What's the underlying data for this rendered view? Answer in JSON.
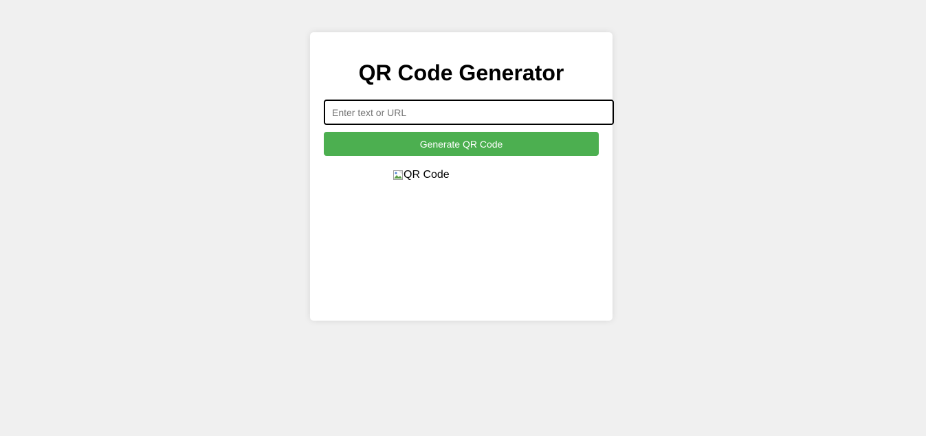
{
  "page": {
    "title": "QR Code Generator"
  },
  "form": {
    "input_placeholder": "Enter text or URL",
    "input_value": "",
    "button_label": "Generate QR Code"
  },
  "qr": {
    "alt_text": "QR Code",
    "icon": "broken-image-icon"
  },
  "colors": {
    "background": "#f0f0f0",
    "card": "#ffffff",
    "button": "#4caf50",
    "button_text": "#ffffff"
  }
}
